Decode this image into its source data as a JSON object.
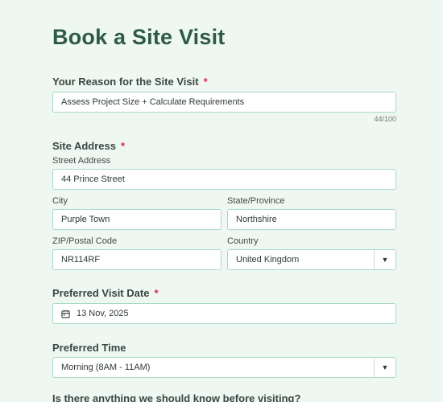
{
  "form": {
    "title": "Book a Site Visit",
    "required_mark": "*",
    "reason": {
      "label": "Your Reason for the Site Visit",
      "value": "Assess Project Size + Calculate Requirements",
      "counter": "44/100"
    },
    "address": {
      "label": "Site Address",
      "street_label": "Street Address",
      "street_value": "44 Prince Street",
      "city_label": "City",
      "city_value": "Purple Town",
      "state_label": "State/Province",
      "state_value": "Northshire",
      "zip_label": "ZIP/Postal Code",
      "zip_value": "NR114RF",
      "country_label": "Country",
      "country_value": "United Kingdom"
    },
    "visit_date": {
      "label": "Preferred Visit Date",
      "value": "13 Nov, 2025",
      "icon": "calendar-icon"
    },
    "visit_time": {
      "label": "Preferred Time",
      "value": "Morning (8AM - 11AM)"
    },
    "notes": {
      "label": "Is there anything we should know before visiting?"
    }
  },
  "colors": {
    "background": "#eff7f2",
    "title": "#2f5a48",
    "field_border": "#a9d9c4",
    "required": "#e0245e"
  }
}
